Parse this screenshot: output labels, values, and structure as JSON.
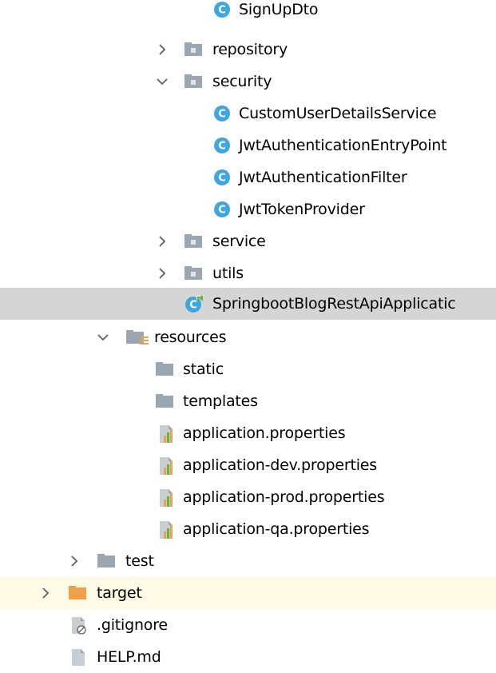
{
  "tree": {
    "sign_up_dto": "SignUpDto",
    "repository": "repository",
    "security": "security",
    "custom_user_details_service": "CustomUserDetailsService",
    "jwt_authentication_entry_point": "JwtAuthenticationEntryPoint",
    "jwt_authentication_filter": "JwtAuthenticationFilter",
    "jwt_token_provider": "JwtTokenProvider",
    "service": "service",
    "utils": "utils",
    "springboot_app": "SpringbootBlogRestApiApplicatic",
    "resources": "resources",
    "static": "static",
    "templates": "templates",
    "application_properties": "application.properties",
    "application_dev_properties": "application-dev.properties",
    "application_prod_properties": "application-prod.properties",
    "application_qa_properties": "application-qa.properties",
    "test": "test",
    "target": "target",
    "gitignore": ".gitignore",
    "help_md": "HELP.md"
  },
  "colors": {
    "class_icon": "#3ea8de",
    "package_folder": "#9aa7b0",
    "excluded_folder": "#f0a04b",
    "selection_bg": "#d5d5d5",
    "highlight_bg": "#fdfae6"
  }
}
